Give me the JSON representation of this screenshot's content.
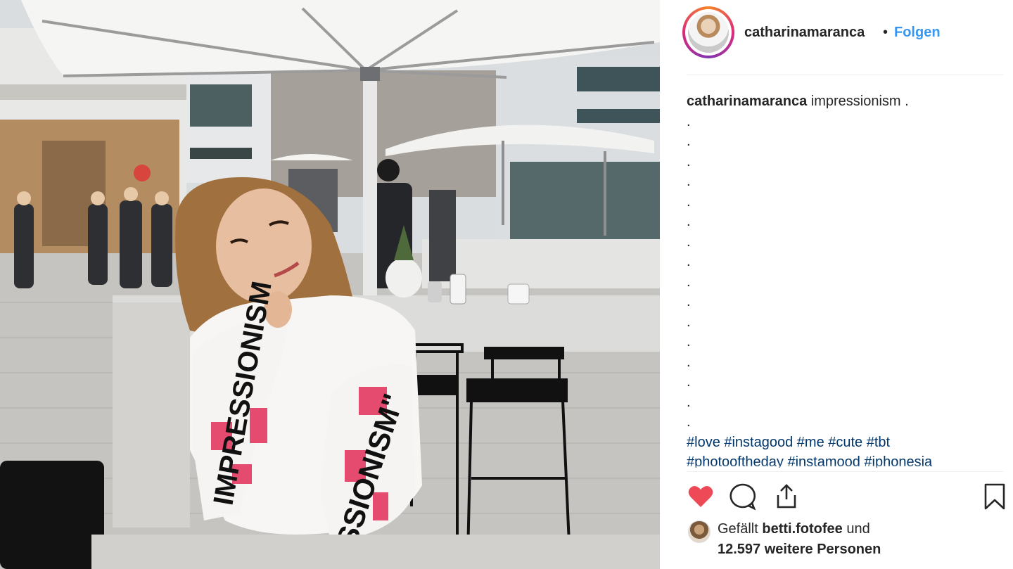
{
  "post": {
    "username": "catharinamaranca",
    "separator": "•",
    "follow_label": "Folgen",
    "caption_user": "catharinamaranca",
    "caption_text": "impressionism .",
    "caption_dots": [
      ".",
      ".",
      ".",
      ".",
      ".",
      ".",
      ".",
      ".",
      ".",
      ".",
      ".",
      ".",
      ".",
      ".",
      ".",
      "."
    ],
    "hashtags_line1": "#love #instagood #me #cute #tbt",
    "hashtags_line2": "#photooftheday #instamood #iphonesia",
    "liked_by_prefix": "Gefällt ",
    "liked_by_user": "betti.fotofee",
    "liked_by_suffix": " und",
    "likes_count_text": "12.597 weitere Personen"
  },
  "photo": {
    "sweater_text_left": "IMPRESSIONISM",
    "sweater_text_right": "SSIONISM\""
  },
  "icons": {
    "like": "heart-icon",
    "comment": "comment-icon",
    "share": "share-icon",
    "save": "bookmark-icon"
  },
  "colors": {
    "like_red": "#ed4956",
    "link_blue": "#3897f0",
    "hashtag_blue": "#003569",
    "text": "#262626"
  }
}
